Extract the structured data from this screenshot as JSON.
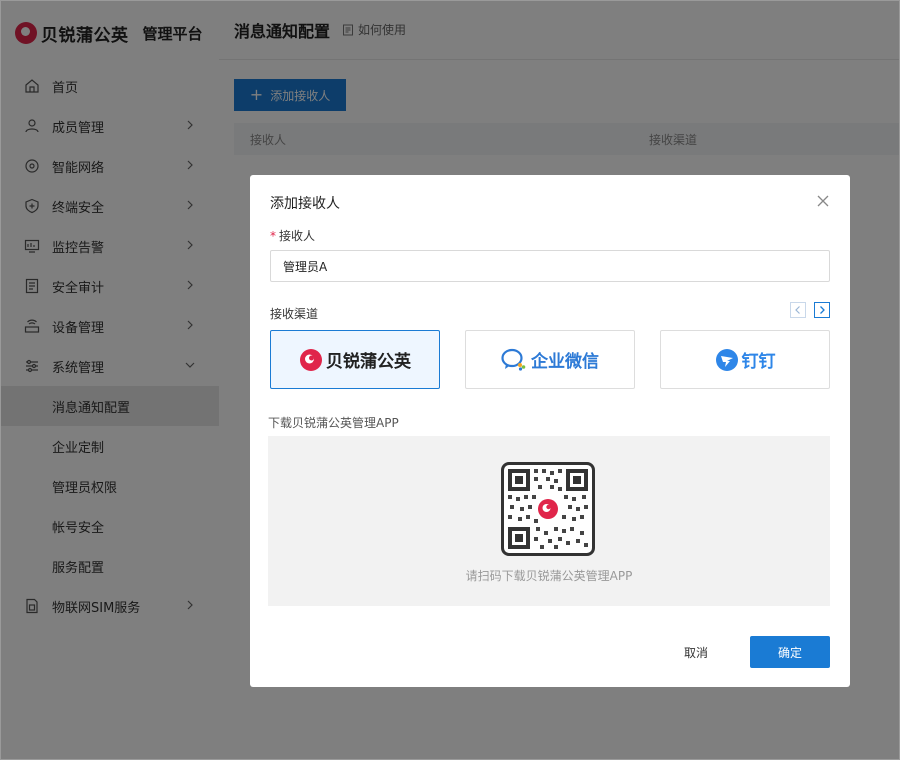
{
  "brand": {
    "name": "贝锐蒲公英",
    "subtitle": "管理平台"
  },
  "sidebar": {
    "items": [
      {
        "label": "首页",
        "icon": "home-icon",
        "expandable": false
      },
      {
        "label": "成员管理",
        "icon": "user-icon",
        "expandable": true
      },
      {
        "label": "智能网络",
        "icon": "network-icon",
        "expandable": true
      },
      {
        "label": "终端安全",
        "icon": "shield-icon",
        "expandable": true
      },
      {
        "label": "监控告警",
        "icon": "monitor-icon",
        "expandable": true
      },
      {
        "label": "安全审计",
        "icon": "audit-icon",
        "expandable": true
      },
      {
        "label": "设备管理",
        "icon": "router-icon",
        "expandable": true
      },
      {
        "label": "系统管理",
        "icon": "settings-icon",
        "expandable": true,
        "expanded": true
      }
    ],
    "subitems": [
      {
        "label": "消息通知配置",
        "active": true
      },
      {
        "label": "企业定制",
        "active": false
      },
      {
        "label": "管理员权限",
        "active": false
      },
      {
        "label": "帐号安全",
        "active": false
      },
      {
        "label": "服务配置",
        "active": false
      }
    ],
    "last_item": {
      "label": "物联网SIM服务",
      "icon": "sim-icon",
      "expandable": true
    }
  },
  "header": {
    "title": "消息通知配置",
    "help": "如何使用"
  },
  "main": {
    "add_button": "添加接收人",
    "table": {
      "columns": [
        "接收人",
        "接收渠道"
      ]
    }
  },
  "modal": {
    "title": "添加接收人",
    "recipient_label": "接收人",
    "required_mark": "*",
    "recipient_value": "管理员A",
    "channel_label": "接收渠道",
    "channels": [
      {
        "name": "贝锐蒲公英",
        "selected": true
      },
      {
        "name": "企业微信",
        "selected": false
      },
      {
        "name": "钉钉",
        "selected": false
      }
    ],
    "download_label": "下载贝锐蒲公英管理APP",
    "qr_tip": "请扫码下载贝锐蒲公英管理APP",
    "cancel": "取消",
    "confirm": "确定"
  },
  "colors": {
    "accent": "#1a7bd4",
    "brand": "#e0254a",
    "overlay": "rgba(0,0,0,0.5)"
  }
}
